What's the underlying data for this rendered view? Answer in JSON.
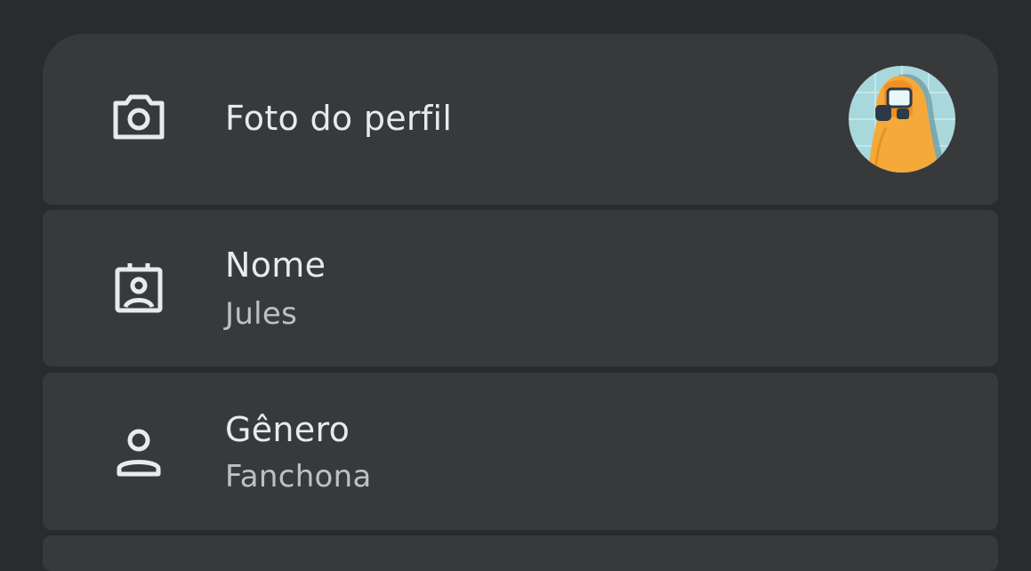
{
  "profile_photo": {
    "label": "Foto do perfil",
    "icon": "camera-icon"
  },
  "name": {
    "label": "Nome",
    "value": "Jules",
    "icon": "badge-icon"
  },
  "gender": {
    "label": "Gênero",
    "value": "Fanchona",
    "icon": "person-icon"
  },
  "colors": {
    "background": "#2a2b2d",
    "card": "#38393b",
    "primary_text": "#e8eaed",
    "secondary_text": "#bdc1c6"
  }
}
